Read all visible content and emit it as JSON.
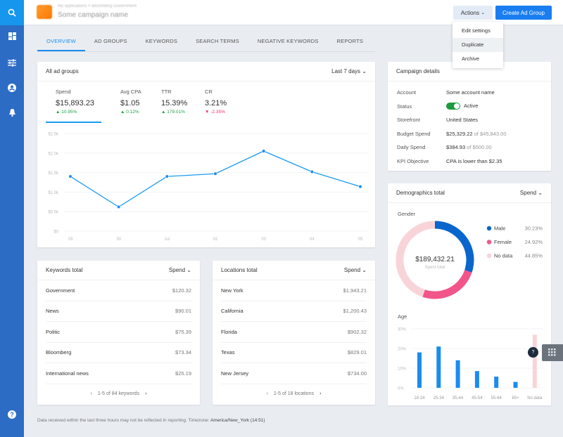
{
  "sidebar": {
    "items": [
      {
        "icon": "search-icon"
      },
      {
        "icon": "dashboard-icon"
      },
      {
        "icon": "sliders-icon"
      },
      {
        "icon": "account-icon"
      },
      {
        "icon": "bell-icon"
      },
      {
        "icon": "help-icon"
      }
    ]
  },
  "header": {
    "breadcrumb": [
      "My applications",
      "Bloomberg Government"
    ],
    "title": "Some campaign name",
    "actions_label": "Actions",
    "create_label": "Create Ad Group"
  },
  "actions_menu": [
    "Edit settings",
    "Duplicate",
    "Archive"
  ],
  "tabs": [
    "OVERVIEW",
    "AD GROUPS",
    "KEYWORDS",
    "SEARCH TERMS",
    "NEGATIVE KEYWORDS",
    "REPORTS"
  ],
  "ad_groups": {
    "title": "All ad groups",
    "range": "Last 7 days",
    "stats": [
      {
        "label": "Spend",
        "value": "$15,893.23",
        "delta": "10.95%",
        "dir": "up"
      },
      {
        "label": "Avg CPA",
        "value": "$1.05",
        "delta": "0.12%",
        "dir": "up"
      },
      {
        "label": "TTR",
        "value": "15.39%",
        "delta": "179.01%",
        "dir": "up"
      },
      {
        "label": "CR",
        "value": "3.21%",
        "delta": "-2.35%",
        "dir": "down"
      }
    ]
  },
  "campaign": {
    "title": "Campaign details",
    "rows": [
      {
        "k": "Account",
        "v": "Some account name"
      },
      {
        "k": "Status",
        "v": "Active"
      },
      {
        "k": "Storefront",
        "v": "United States"
      },
      {
        "k": "Budget Spend",
        "v": "$25,329.22",
        "extra": "of $45,843.00"
      },
      {
        "k": "Daily Spend",
        "v": "$384.93",
        "extra": "of $500.00"
      },
      {
        "k": "KPI Objective",
        "v": "CPA is lower than $2.35"
      }
    ]
  },
  "keywords": {
    "title": "Keywords total",
    "sort": "Spend",
    "rows": [
      {
        "k": "Government",
        "v": "$120.32"
      },
      {
        "k": "News",
        "v": "$90.01"
      },
      {
        "k": "Politic",
        "v": "$75.39"
      },
      {
        "k": "Bloomberg",
        "v": "$73.34"
      },
      {
        "k": "International news",
        "v": "$25.19"
      }
    ],
    "pager": "1-5 of 84 keywords"
  },
  "locations": {
    "title": "Locations total",
    "sort": "Spend",
    "rows": [
      {
        "k": "New York",
        "v": "$1,943.21"
      },
      {
        "k": "California",
        "v": "$1,200.43"
      },
      {
        "k": "Florida",
        "v": "$902.32"
      },
      {
        "k": "Texas",
        "v": "$829.01"
      },
      {
        "k": "New Jersey",
        "v": "$734.00"
      }
    ],
    "pager": "1-5 of 18 locations"
  },
  "demographics": {
    "title": "Demographics total",
    "sort": "Spend",
    "gender_label": "Gender",
    "age_label": "Age",
    "total": "$189,432.21",
    "total_label": "Spent total"
  },
  "footer": {
    "note": "Data received within the last three hours may not be reflected in reporting. Timezone: ",
    "tz": "America/New_York (14:51)"
  },
  "colors": {
    "accent": "#1a8cf0",
    "male": "#0a66cc",
    "female": "#f2558a",
    "nodata": "#f8d4d8",
    "up": "#21a04a",
    "down": "#f0306a"
  },
  "chart_data": [
    {
      "type": "line",
      "x": [
        "29",
        "30",
        "Jul",
        "02",
        "03",
        "04",
        "05"
      ],
      "values": [
        1400,
        620,
        1400,
        1470,
        2050,
        1520,
        1140
      ],
      "yticks": [
        "$0",
        "$0.5k",
        "$1.0k",
        "$1.5k",
        "$2.0k",
        "$2.5k"
      ],
      "ylim": [
        0,
        2500
      ],
      "grid": true
    },
    {
      "type": "pie",
      "categories": [
        "Male",
        "Female",
        "No data"
      ],
      "labels": [
        "30.23%",
        "24.92%",
        "44.85%"
      ],
      "values": [
        30.23,
        24.92,
        44.85
      ]
    },
    {
      "type": "bar",
      "categories": [
        "18-24",
        "25-34",
        "35-44",
        "45-54",
        "55-64",
        "65+",
        "No data"
      ],
      "values": [
        18,
        21,
        14,
        8.5,
        5.7,
        3,
        27
      ],
      "yticks": [
        "0%",
        "10%",
        "20%",
        "30%"
      ],
      "ylim": [
        0,
        30
      ],
      "grid": true
    }
  ]
}
